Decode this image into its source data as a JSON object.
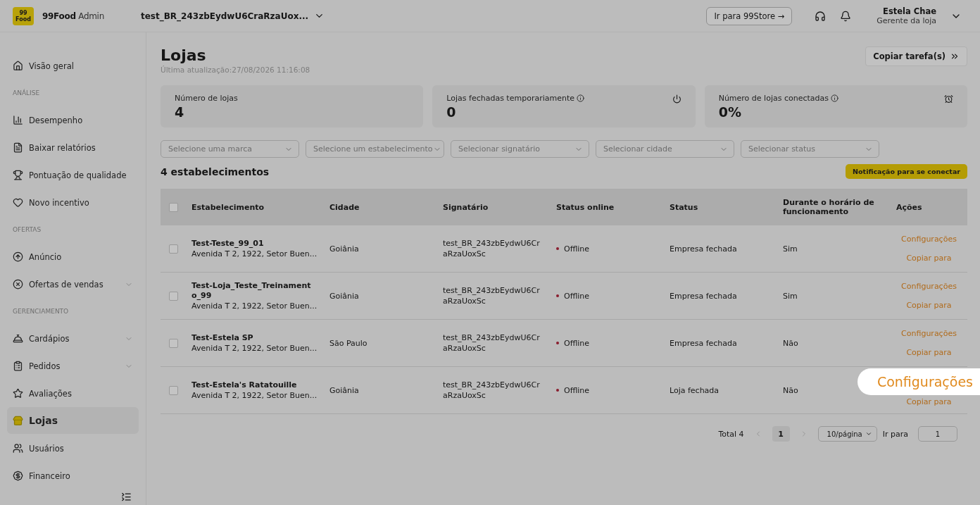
{
  "header": {
    "brand": "99Food",
    "brand_suffix": "Admin",
    "logo_text": [
      "99",
      "Food"
    ],
    "store_select": "test_BR_243zbEydwU6CraRzaUox...",
    "store_button": "Ir para 99Store →",
    "user_name": "Estela Chae",
    "user_role": "Gerente da loja"
  },
  "sidebar": {
    "items": [
      {
        "kind": "item",
        "label": "Visão geral",
        "selected": false,
        "expandable": false
      },
      {
        "kind": "section",
        "label": "ANÁLISE"
      },
      {
        "kind": "item",
        "label": "Desempenho",
        "selected": false,
        "expandable": false
      },
      {
        "kind": "item",
        "label": "Baixar relatórios",
        "selected": false,
        "expandable": false
      },
      {
        "kind": "item",
        "label": "Pontuação de qualidade",
        "selected": false,
        "expandable": false
      },
      {
        "kind": "item",
        "label": "Novo incentivo",
        "selected": false,
        "expandable": false
      },
      {
        "kind": "section",
        "label": "OFERTAS"
      },
      {
        "kind": "item",
        "label": "Anúncio",
        "selected": false,
        "expandable": false
      },
      {
        "kind": "item",
        "label": "Ofertas de vendas",
        "selected": false,
        "expandable": true
      },
      {
        "kind": "section",
        "label": "GERENCIAMENTO"
      },
      {
        "kind": "item",
        "label": "Cardápios",
        "selected": false,
        "expandable": true
      },
      {
        "kind": "item",
        "label": "Pedidos",
        "selected": false,
        "expandable": true
      },
      {
        "kind": "item",
        "label": "Avaliações",
        "selected": false,
        "expandable": false
      },
      {
        "kind": "item",
        "label": "Lojas",
        "selected": true,
        "expandable": false
      },
      {
        "kind": "item",
        "label": "Usuários",
        "selected": false,
        "expandable": false
      },
      {
        "kind": "item",
        "label": "Financeiro",
        "selected": false,
        "expandable": false
      }
    ]
  },
  "page": {
    "title": "Lojas",
    "updated": "Última atualização:27/08/2026 11:16:08",
    "copy_button": "Copiar tarefa(s)"
  },
  "stats": [
    {
      "label": "Número de lojas",
      "value": "4",
      "info": false
    },
    {
      "label": "Lojas fechadas temporariamente",
      "value": "0",
      "info": true
    },
    {
      "label": "Número de lojas conectadas",
      "value": "0%",
      "info": true
    }
  ],
  "filters": [
    {
      "placeholder": "Selecione uma marca"
    },
    {
      "placeholder": "Selecione um estabelecimento"
    },
    {
      "placeholder": "Selecionar signatário"
    },
    {
      "placeholder": "Selecionar cidade"
    },
    {
      "placeholder": "Selecionar status"
    }
  ],
  "count": "4 estabelecimentos",
  "notify_button": "Notificação para se conectar",
  "table": {
    "all_checked": false,
    "columns": [
      "Estabelecimento",
      "Cidade",
      "Signatário",
      "Status online",
      "Status",
      "Durante o horário de funcionamento",
      "Ações"
    ],
    "rows": [
      {
        "checked": false,
        "name": "Test-Teste_99_01",
        "address": "Avenida T 2, 1922, Setor Buen...",
        "city": "Goiânia",
        "signer": "test_BR_243zbEydwU6CraRzaUoxSc",
        "online": "Offline",
        "status": "Empresa fechada",
        "hours": "Sim",
        "actions": [
          {
            "label": "Configurações",
            "highlighted": false
          },
          {
            "label": "Copiar para",
            "highlighted": false
          }
        ]
      },
      {
        "checked": false,
        "name": "Test-Loja_Teste_Treinamento_99",
        "address": "Avenida T 2, 1922, Setor Buen...",
        "city": "Goiânia",
        "signer": "test_BR_243zbEydwU6CraRzaUoxSc",
        "online": "Offline",
        "status": "Empresa fechada",
        "hours": "Sim",
        "actions": [
          {
            "label": "Configurações",
            "highlighted": false
          },
          {
            "label": "Copiar para",
            "highlighted": false
          }
        ]
      },
      {
        "checked": false,
        "name": "Test-Estela SP",
        "address": "Avenida T 2, 1922, Setor Buen...",
        "city": "São Paulo",
        "signer": "test_BR_243zbEydwU6CraRzaUoxSc",
        "online": "Offline",
        "status": "Empresa fechada",
        "hours": "Não",
        "actions": [
          {
            "label": "Configurações",
            "highlighted": false
          },
          {
            "label": "Copiar para",
            "highlighted": false
          }
        ]
      },
      {
        "checked": false,
        "name": "Test-Estela's Ratatouille",
        "address": "Avenida T 2, 1922, Setor Buen...",
        "city": "Goiânia",
        "signer": "test_BR_243zbEydwU6CraRzaUoxSc",
        "online": "Offline",
        "status": "Loja fechada",
        "hours": "Não",
        "actions": [
          {
            "label": "Configurações",
            "highlighted": true
          },
          {
            "label": "Copiar para",
            "highlighted": false
          }
        ]
      }
    ]
  },
  "pagination": {
    "total": "Total 4",
    "pages": [
      {
        "label": "1",
        "selected": true
      }
    ],
    "page_size": "10/página",
    "goto_label": "Ir para",
    "goto_value": "1"
  }
}
